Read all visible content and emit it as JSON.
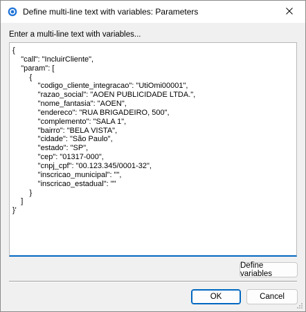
{
  "window": {
    "title": "Define multi-line text with variables: Parameters",
    "close_glyph": "✕",
    "icon": "app-icon",
    "accent": "#0067c0"
  },
  "prompt_label": "Enter a multi-line text with variables...",
  "editor": {
    "value": "{\n    \"call\": \"IncluirCliente\",\n    \"param\": [\n        {\n            \"codigo_cliente_integracao\": \"UtiOmi00001\",\n            \"razao_social\": \"AOEN PUBLICIDADE LTDA.\",\n            \"nome_fantasia\": \"AOEN\",\n            \"endereco\": \"RUA BRIGADEIRO, 500\",\n            \"complemento\": \"SALA 1\",\n            \"bairro\": \"BELA VISTA\",\n            \"cidade\": \"São Paulo\",\n            \"estado\": \"SP\",\n            \"cep\": \"01317-000\",\n            \"cnpj_cpf\": \"00.123.345/0001-32\",\n            \"inscricao_municipal\": \"\",\n            \"inscricao_estadual\": \"\"\n        }\n    ]\n}'"
  },
  "buttons": {
    "define_variables": "Define variables",
    "ok": "OK",
    "cancel": "Cancel"
  }
}
